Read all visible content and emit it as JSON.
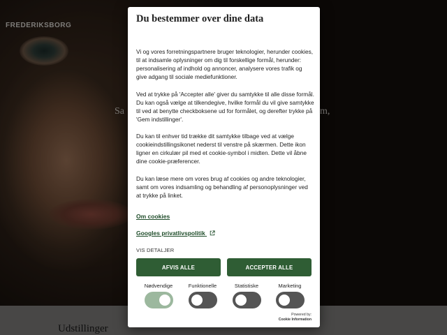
{
  "site": {
    "logo": "FREDERIKSBORG",
    "hero_left": "Sa",
    "hero_right": "m,",
    "section_heading": "Udstillinger"
  },
  "consent": {
    "title": "Du bestemmer over dine data",
    "paragraphs": [
      "Vi og vores forretningspartnere bruger teknologier, herunder cookies, til at indsamle oplysninger om dig til forskellige formål, herunder: personalisering af indhold og annoncer, analysere vores trafik og give adgang til sociale mediefunktioner.",
      "Ved at trykke på 'Accepter alle' giver du samtykke til alle disse formål. Du kan også vælge at tilkendegive, hvilke formål du vil give samtykke til ved at benytte checkboksene ud for formålet, og derefter trykke på 'Gem indstillinger'.",
      "Du kan til enhver tid trække dit samtykke tilbage ved at vælge cookieindstillingsikonet nederst til venstre på skærmen. Dette ikon ligner en cirkulær pil med et cookie-symbol i midten. Dette vil åbne dine cookie-præferencer.",
      "Du kan læse mere om vores brug af cookies og andre teknologier, samt om vores indsamling og behandling af personoplysninger ved at trykke på linket."
    ],
    "link_cookies": "Om cookies",
    "link_google": "Googles privatlivspolitik",
    "details_label": "VIS DETALJER",
    "reject_label": "AFVIS ALLE",
    "accept_label": "ACCEPTER ALLE",
    "toggles": [
      {
        "label": "Nødvendige",
        "on": true
      },
      {
        "label": "Funktionelle",
        "on": false
      },
      {
        "label": "Statistiske",
        "on": false
      },
      {
        "label": "Marketing",
        "on": false
      }
    ],
    "powered_by": "Powered by:",
    "powered_name": "Cookie Information"
  },
  "colors": {
    "button_green": "#2f5d34",
    "link_green": "#1f4d2a",
    "toggle_on": "#9cb89e",
    "toggle_off": "#555555"
  }
}
